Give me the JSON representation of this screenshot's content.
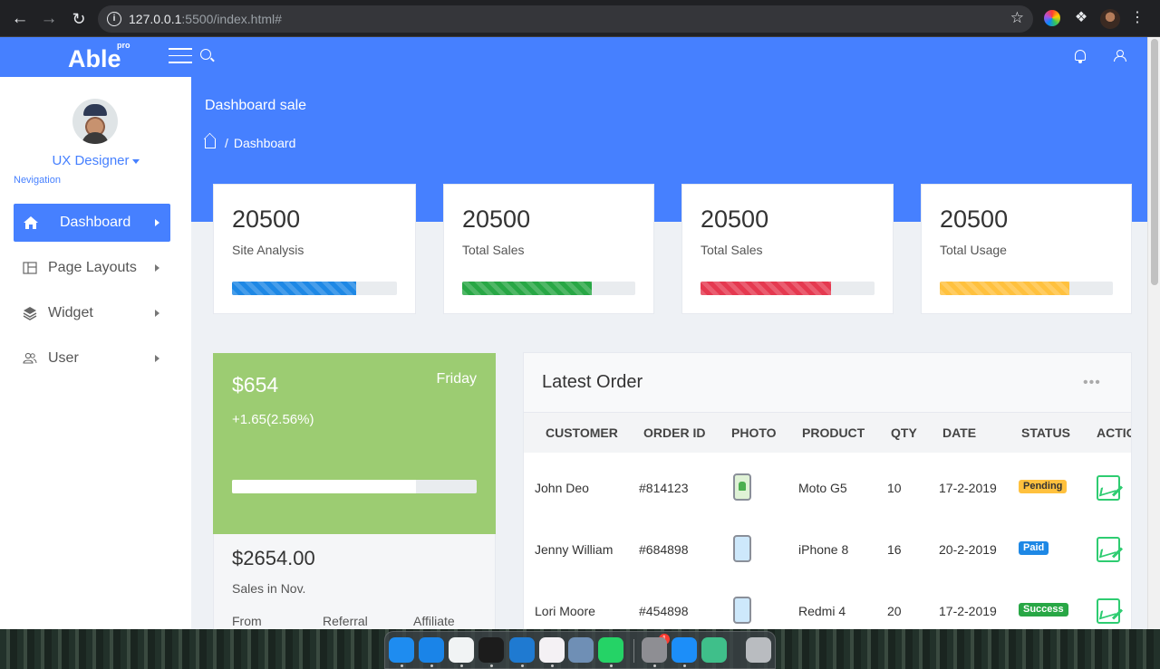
{
  "browser": {
    "url_host": "127.0.0.1",
    "url_rest": ":5500/index.html#",
    "back_icon": "arrow-left-icon",
    "forward_icon": "arrow-right-icon",
    "reload_icon": "reload-icon"
  },
  "app": {
    "logo": "Able",
    "logo_tag": "pro"
  },
  "sidebar": {
    "role": "UX Designer",
    "caption": "Nevigation",
    "items": [
      {
        "label": "Dashboard",
        "icon": "home-icon",
        "active": true
      },
      {
        "label": "Page Layouts",
        "icon": "layout-icon",
        "active": false
      },
      {
        "label": "Widget",
        "icon": "layers-icon",
        "active": false
      },
      {
        "label": "User",
        "icon": "users-icon",
        "active": false
      }
    ]
  },
  "page": {
    "title": "Dashboard sale",
    "breadcrumb": "Dashboard"
  },
  "stats": [
    {
      "value": "20500",
      "label": "Site Analysis",
      "progress": 0.75,
      "color": "#1e88e5"
    },
    {
      "value": "20500",
      "label": "Total Sales",
      "progress": 0.75,
      "color": "#28a745"
    },
    {
      "value": "20500",
      "label": "Total Sales",
      "progress": 0.75,
      "color": "#e53950"
    },
    {
      "value": "20500",
      "label": "Total Usage",
      "progress": 0.75,
      "color": "#ffc13e"
    }
  ],
  "revenue": {
    "amount": "$654",
    "day": "Friday",
    "change": "+1.65(2.56%)",
    "progress": 0.75,
    "total": "$2654.00",
    "period": "Sales in Nov.",
    "columns": [
      "From",
      "Referral",
      "Affiliate"
    ]
  },
  "orders": {
    "title": "Latest Order",
    "menu_icon": "more-horizontal-icon",
    "headers": [
      "CUSTOMER",
      "ORDER ID",
      "PHOTO",
      "PRODUCT",
      "QTY",
      "DATE",
      "STATUS",
      "ACTIO"
    ],
    "rows": [
      {
        "customer": "John Deo",
        "order_id": "#814123",
        "photo": "android-phone-icon",
        "product": "Moto G5",
        "qty": "10",
        "date": "17-2-2019",
        "status": "Pending",
        "status_bg": "#ffc13e",
        "status_fg": "#333"
      },
      {
        "customer": "Jenny William",
        "order_id": "#684898",
        "photo": "iphone-icon",
        "product": "iPhone 8",
        "qty": "16",
        "date": "20-2-2019",
        "status": "Paid",
        "status_bg": "#1e88e5",
        "status_fg": "#fff"
      },
      {
        "customer": "Lori Moore",
        "order_id": "#454898",
        "photo": "phone-icon",
        "product": "Redmi 4",
        "qty": "20",
        "date": "17-2-2019",
        "status": "Success",
        "status_bg": "#28a745",
        "status_fg": "#fff"
      }
    ]
  },
  "dock": {
    "badge_count": "1",
    "apps": [
      {
        "name": "finder-icon",
        "color": "#1e8cf0"
      },
      {
        "name": "safari-icon",
        "color": "#1a84e8"
      },
      {
        "name": "chrome-icon",
        "color": "#f1f3f4"
      },
      {
        "name": "terminal-icon",
        "color": "#1c1c1c"
      },
      {
        "name": "vscode-icon",
        "color": "#1f7ad1"
      },
      {
        "name": "slack-icon",
        "color": "#f4f1f4"
      },
      {
        "name": "preview-icon",
        "color": "#6f8fb5"
      },
      {
        "name": "whatsapp-icon",
        "color": "#25d366"
      },
      {
        "name": "system-preferences-icon",
        "color": "#8e8e93"
      },
      {
        "name": "app-store-icon",
        "color": "#1c8ef9"
      },
      {
        "name": "atom-icon",
        "color": "#3fbf8a"
      },
      {
        "name": "trash-icon",
        "color": "#b9bcc0"
      }
    ]
  }
}
